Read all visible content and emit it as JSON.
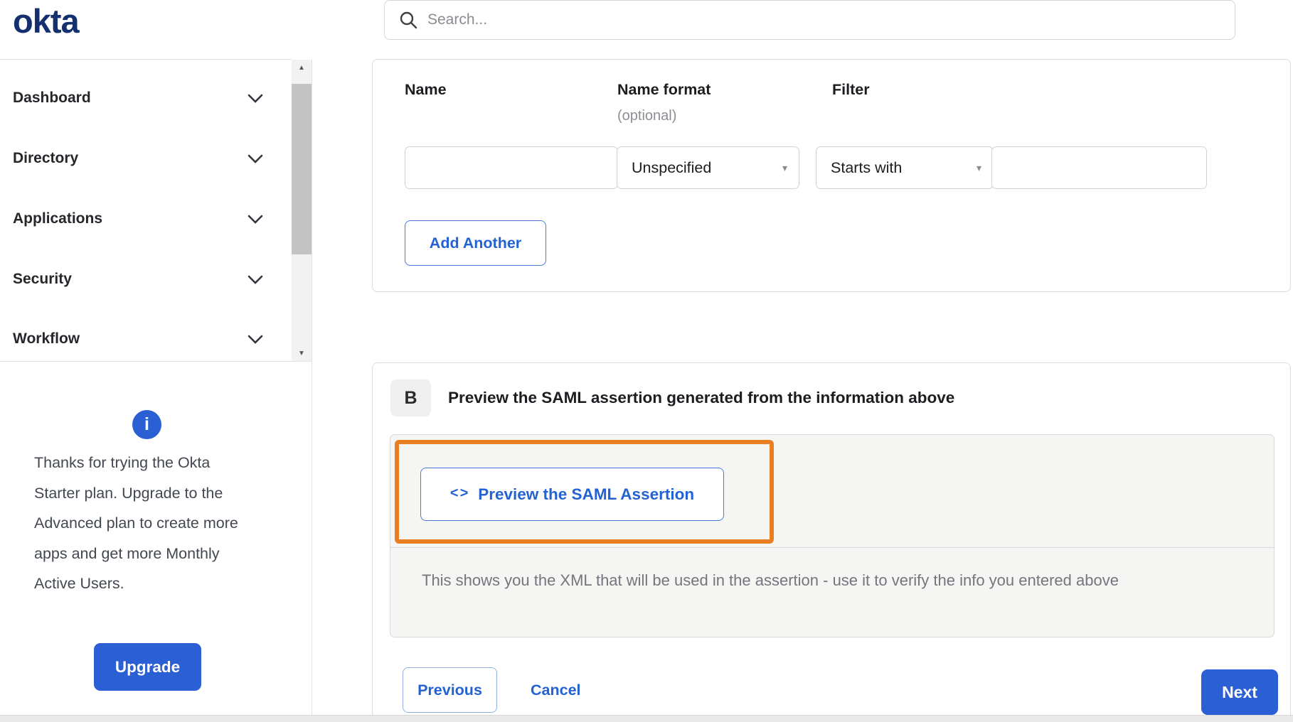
{
  "brand": {
    "logo_text": "okta"
  },
  "search": {
    "placeholder": "Search...",
    "icon": "search-icon"
  },
  "sidebar": {
    "items": [
      {
        "label": "Dashboard"
      },
      {
        "label": "Directory"
      },
      {
        "label": "Applications"
      },
      {
        "label": "Security"
      },
      {
        "label": "Workflow"
      }
    ],
    "upsell": {
      "icon": "info-icon",
      "icon_glyph": "i",
      "message": "Thanks for trying the Okta Starter plan. Upgrade to the Advanced plan to create more apps and get more Monthly Active Users.",
      "upgrade_label": "Upgrade"
    }
  },
  "attribute_form": {
    "columns": {
      "name_label": "Name",
      "format_label": "Name format",
      "format_hint": "(optional)",
      "filter_label": "Filter"
    },
    "row": {
      "name_value": "",
      "name_format_selected": "Unspecified",
      "filter_op_selected": "Starts with",
      "filter_value": ""
    },
    "add_another_label": "Add Another"
  },
  "preview_section": {
    "badge": "B",
    "heading": "Preview the SAML assertion generated from the information above",
    "button_icon_glyph": "<>",
    "button_label": "Preview the SAML Assertion",
    "description": "This shows you the XML that will be used in the assertion - use it to verify the info you entered above"
  },
  "wizard_nav": {
    "previous_label": "Previous",
    "cancel_label": "Cancel",
    "next_label": "Next"
  },
  "icons": {
    "scroll_up": "▲",
    "scroll_down": "▼",
    "caret": "▾"
  },
  "colors": {
    "accent_blue": "#2b60d4",
    "logo_navy": "#14306e",
    "annotation_orange": "#e87f22",
    "panel_gray": "#f5f5f3"
  }
}
